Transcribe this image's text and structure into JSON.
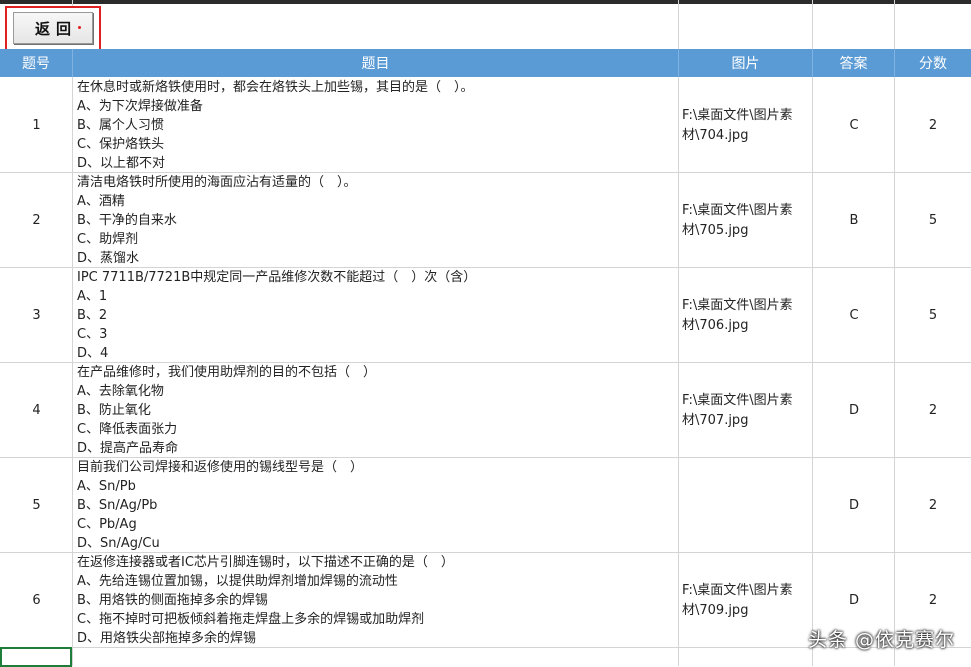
{
  "back_button": {
    "label": "返回"
  },
  "headers": {
    "num": "题号",
    "question": "题目",
    "picture": "图片",
    "answer": "答案",
    "score": "分数"
  },
  "rows": [
    {
      "num": "1",
      "lines": [
        "在休息时或新烙铁使用时，都会在烙铁头上加些锡，其目的是（　）。",
        "A、为下次焊接做准备",
        "B、属个人习惯",
        "C、保护烙铁头",
        "D、以上都不对"
      ],
      "pic": [
        "F:\\桌面文件\\图片素",
        "材\\704.jpg"
      ],
      "answer": "C",
      "score": "2"
    },
    {
      "num": "2",
      "lines": [
        "清洁电烙铁时所使用的海面应沾有适量的（　）。",
        "A、酒精",
        "B、干净的自来水",
        "C、助焊剂",
        "D、蒸馏水"
      ],
      "pic": [
        "F:\\桌面文件\\图片素",
        "材\\705.jpg"
      ],
      "answer": "B",
      "score": "5"
    },
    {
      "num": "3",
      "lines": [
        "IPC 7711B/7721B中规定同一产品维修次数不能超过（　）次（含）",
        "A、1",
        "B、2",
        "C、3",
        "D、4"
      ],
      "pic": [
        "F:\\桌面文件\\图片素",
        "材\\706.jpg"
      ],
      "answer": "C",
      "score": "5"
    },
    {
      "num": "4",
      "lines": [
        "在产品维修时，我们使用助焊剂的目的不包括（　）",
        "A、去除氧化物",
        "B、防止氧化",
        "C、降低表面张力",
        "D、提高产品寿命"
      ],
      "pic": [
        "F:\\桌面文件\\图片素",
        "材\\707.jpg"
      ],
      "answer": "D",
      "score": "2"
    },
    {
      "num": "5",
      "lines": [
        "目前我们公司焊接和返修使用的锡线型号是（　）",
        "A、Sn/Pb",
        "B、Sn/Ag/Pb",
        "C、Pb/Ag",
        "D、Sn/Ag/Cu"
      ],
      "pic": [
        "",
        ""
      ],
      "answer": "D",
      "score": "2"
    },
    {
      "num": "6",
      "lines": [
        "在返修连接器或者IC芯片引脚连锡时，以下描述不正确的是（　）",
        "A、先给连锡位置加锡，以提供助焊剂增加焊锡的流动性",
        "B、用烙铁的侧面拖掉多余的焊锡",
        "C、拖不掉时可把板倾斜着拖走焊盘上多余的焊锡或加助焊剂",
        "D、用烙铁尖部拖掉多余的焊锡"
      ],
      "pic": [
        "F:\\桌面文件\\图片素",
        "材\\709.jpg"
      ],
      "answer": "D",
      "score": "2"
    }
  ],
  "watermark": "头条 @依克赛尔"
}
